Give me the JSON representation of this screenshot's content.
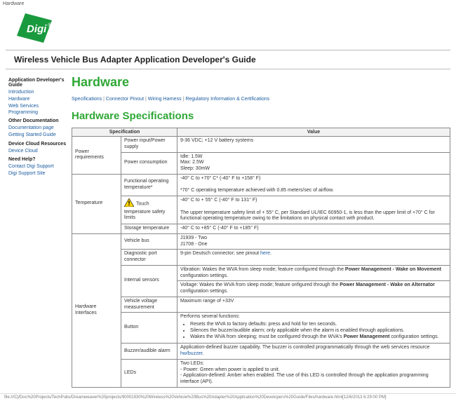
{
  "top_label": "Hardware",
  "doc_title": "Wireless Vehicle Bus Adapter Application Developer's Guide",
  "sidebar": {
    "groups": [
      {
        "title": "Application Developer's Guide",
        "items": [
          {
            "label": "Introduction"
          },
          {
            "label": "Hardware"
          },
          {
            "label": "Web Services Programming"
          }
        ]
      },
      {
        "title": "Other Documentation",
        "items": [
          {
            "label": "Documentation page"
          },
          {
            "label": "Getting Started Guide"
          }
        ]
      },
      {
        "title": "Device Cloud Resources",
        "items": [
          {
            "label": "Device Cloud"
          }
        ]
      },
      {
        "title": "Need Help?",
        "items": [
          {
            "label": "Contact Digi Support"
          },
          {
            "label": "Digi Support Site"
          }
        ]
      }
    ]
  },
  "main": {
    "page_title": "Hardware",
    "quicklinks": {
      "items": [
        "Specifications",
        "Connector Pinout",
        "Wiring Harness",
        "Regulatory Information & Certifications"
      ],
      "sep": " | "
    },
    "section_title": "Hardware Specifications",
    "table": {
      "headers": {
        "spec": "Specification",
        "value": "Value"
      },
      "groups": [
        {
          "group": "Power requirements",
          "rows": [
            {
              "sub": "Power input/Power supply",
              "value_html": "9-36 VDC; +12 V battery systems"
            },
            {
              "sub": "Power consumption",
              "value_html": "Idle: 1.5W<br>Max: 2.5W<br>Sleep: 30mW"
            }
          ]
        },
        {
          "group": "Temperature",
          "rows": [
            {
              "sub": "Functional operating temperature*",
              "value_html": "-40° C to +70° C* (-40° F to +158° F)<br><br>*70° C operating temperature achieved with 0.85 meters/sec of airflow."
            },
            {
              "sub": "__WARN__Touch temperature safety limits",
              "value_html": "-40° C to + 55° C (-40° F to 131° F)<br><br>The upper temperature safety limit of + 55° C, per Standard UL/IEC 60950-1, is less than the upper limit of +70° C for functional operating temperature owing to the limitations on physical contact with product."
            },
            {
              "sub": "Storage temperature",
              "value_html": "-40° C to +85° C (-40° F to +185° F)"
            }
          ]
        },
        {
          "group": "Hardware Interfaces",
          "rows": [
            {
              "sub": "Vehicle bus",
              "value_html": "J1939 - Two<br>J1708 - One"
            },
            {
              "sub": "Diagnostic port connector",
              "value_html": "9-pin Deutsch connector; see pinout <a class='inline-link' href='#'>here</a>."
            },
            {
              "sub": "Internal sensors",
              "value_html": "Vibration: Wakes the WVA from sleep mode; feature configured through the <b>Power Management - Wake on Movement</b> configuration settings.<hr style='border:none;border-top:1px solid #888;margin:2px -4px'>Voltage: Wakes the WVA from sleep mode; feature onfigured through the <b>Power Management - Wake on Alternator</b> configuration settings."
            },
            {
              "sub": "Vehicle voltage measurement",
              "value_html": "Maximum range of +33V"
            },
            {
              "sub": "Button",
              "value_html": "Performs several functions:<ul><li>Resets the WVA to factory defaults: press and hold for ten seconds.</li><li>Silences the buzzer/audible alarm; only applicable when the alarm is enabled through applications.</li><li>Wakes the WVA from sleeping; must be configured through the WVA's <b>Power Management</b> configuration settings.</li></ul>"
            },
            {
              "sub": "Buzzer/audible alarm",
              "value_html": "Application-defined buzzer capability. The buzzer is controlled programmatically through the web services resource <a class='inline-link' href='#'>hw/buzzer</a>."
            },
            {
              "sub": "LEDs",
              "value_html": "Two LEDs:<br>- Power: Green when power is applied to unit.<br>- Application-defined: Amber when enabled. The use of this LED is controlled through the application programming interface (API)."
            }
          ]
        }
      ]
    }
  },
  "footer_path": "file:///C|/Doc%20Projects/TechPubs/Dreamweaver%20projects/90001930%20Wireless%20Vehicle%20Bus%20Adapter%20Application%20Developers%20Guide/Files/hardware.html[12/6/2013 6:29:00 PM]"
}
